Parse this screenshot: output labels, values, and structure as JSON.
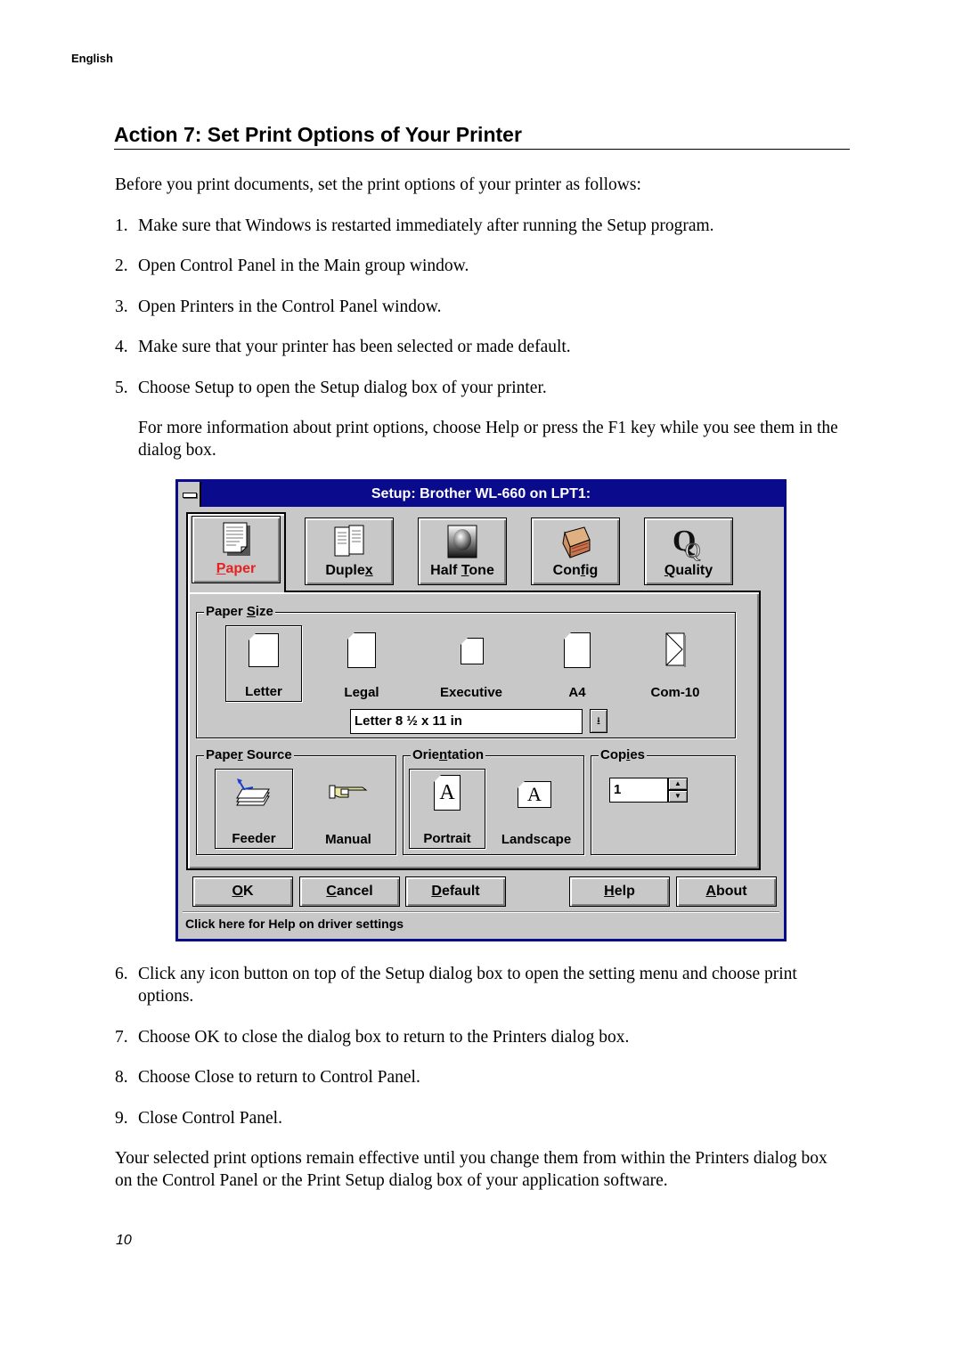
{
  "header": {
    "language": "English"
  },
  "section_title": "Action 7: Set Print Options of Your Printer",
  "intro": "Before you print documents, set the print options of your printer as follows:",
  "steps_before": [
    {
      "num": "1.",
      "text": "Make sure that Windows is restarted immediately after running the Setup program."
    },
    {
      "num": "2.",
      "text": "Open Control Panel in the Main group window."
    },
    {
      "num": "3.",
      "text": "Open Printers in the Control Panel window."
    },
    {
      "num": "4.",
      "text": "Make sure that your printer has been selected or made default."
    },
    {
      "num": "5.",
      "text": "Choose Setup to open the Setup dialog box of your printer."
    }
  ],
  "step5_note": "For more information about print options, choose Help or press the F1 key while you see them in the dialog box.",
  "dialog": {
    "title": "Setup: Brother WL-660 on LPT1:",
    "tabs": [
      {
        "label_pre": "",
        "label_u": "P",
        "label_post": "aper",
        "icon": "paper-document-icon",
        "active": true
      },
      {
        "label_pre": "Duple",
        "label_u": "x",
        "label_post": "",
        "icon": "duplex-book-icon",
        "active": false
      },
      {
        "label_pre": "Half ",
        "label_u": "T",
        "label_post": "one",
        "icon": "halftone-sphere-icon",
        "active": false
      },
      {
        "label_pre": "Con",
        "label_u": "f",
        "label_post": "ig",
        "icon": "printer-config-icon",
        "active": false
      },
      {
        "label_pre": "",
        "label_u": "Q",
        "label_post": "uality",
        "icon": "quality-q-icon",
        "active": false
      }
    ],
    "active_tab_color": "#e82020",
    "paper_size": {
      "label_pre": "Paper ",
      "label_u": "S",
      "label_post": "ize",
      "options": [
        "Letter",
        "Legal",
        "Executive",
        "A4",
        "Com-10"
      ],
      "selected": "Letter",
      "combo_value": "Letter 8 ½ x 11 in",
      "combo_arrow": "⭳"
    },
    "paper_source": {
      "label_pre": "Pape",
      "label_u": "r",
      "label_post": " Source",
      "options": [
        "Feeder",
        "Manual"
      ],
      "selected": "Feeder"
    },
    "orientation": {
      "label_pre": "Orie",
      "label_u": "n",
      "label_post": "tation",
      "options": [
        "Portrait",
        "Landscape"
      ],
      "selected": "Portrait",
      "glyph": "A"
    },
    "copies": {
      "label_pre": "Cop",
      "label_u": "i",
      "label_post": "es",
      "value": "1",
      "up": "▲",
      "down": "▼"
    },
    "buttons": [
      {
        "u": "O",
        "rest": "K"
      },
      {
        "u": "C",
        "rest": "ancel"
      },
      {
        "u": "D",
        "rest": "efault"
      },
      {
        "u": "H",
        "rest": "elp"
      },
      {
        "u": "A",
        "rest": "bout"
      }
    ],
    "status_text": "Click here for Help on driver settings"
  },
  "steps_after": [
    {
      "num": "6.",
      "text": "Click any icon button on top of the Setup dialog box to open the setting menu and choose print options."
    },
    {
      "num": "7.",
      "text": "Choose OK to close the dialog box to return to the Printers dialog box."
    },
    {
      "num": "8.",
      "text": "Choose Close to return to Control Panel."
    },
    {
      "num": "9.",
      "text": "Close Control Panel."
    }
  ],
  "closing": "Your selected print options remain effective until you change them from within the Printers dialog box on the Control Panel or the Print Setup dialog box of your application software.",
  "page_number": "10"
}
